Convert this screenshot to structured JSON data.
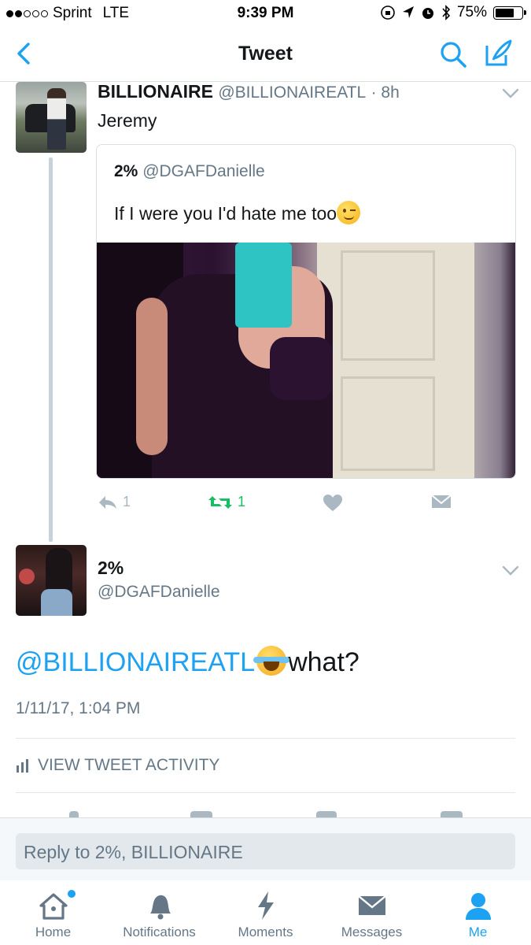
{
  "status_bar": {
    "carrier": "Sprint",
    "network": "LTE",
    "time": "9:39 PM",
    "battery": "75%",
    "battery_level": 0.75,
    "signal_bars_filled": 2,
    "signal_bars_total": 5
  },
  "nav": {
    "title": "Tweet",
    "back_icon": "chevron-left-icon",
    "search_icon": "search-icon",
    "compose_icon": "compose-icon"
  },
  "quoting_tweet": {
    "name": "BILLIONAIRE",
    "handle": "@BILLIONAIREATL",
    "time": "· 8h",
    "text": "Jeremy",
    "quoted": {
      "name": "2%",
      "handle": "@DGAFDanielle",
      "text": "If I were you I'd hate me too"
    },
    "actions": {
      "reply_count": "1",
      "retweet_count": "1"
    }
  },
  "main_tweet": {
    "name": "2%",
    "handle": "@DGAFDanielle",
    "mention": "@BILLIONAIREATL",
    "text": "what?",
    "date": "1/11/17, 1:04 PM",
    "activity_label": "VIEW TWEET ACTIVITY"
  },
  "reply_bar": {
    "placeholder": "Reply to 2%, BILLIONAIRE"
  },
  "tabs": [
    {
      "label": "Home",
      "icon": "home-icon"
    },
    {
      "label": "Notifications",
      "icon": "bell-icon"
    },
    {
      "label": "Moments",
      "icon": "lightning-icon"
    },
    {
      "label": "Messages",
      "icon": "envelope-icon"
    },
    {
      "label": "Me",
      "icon": "person-icon"
    }
  ],
  "colors": {
    "accent": "#1da1f2",
    "retweet": "#17bf63",
    "muted": "#657786",
    "icon_gray": "#aab8c2"
  }
}
